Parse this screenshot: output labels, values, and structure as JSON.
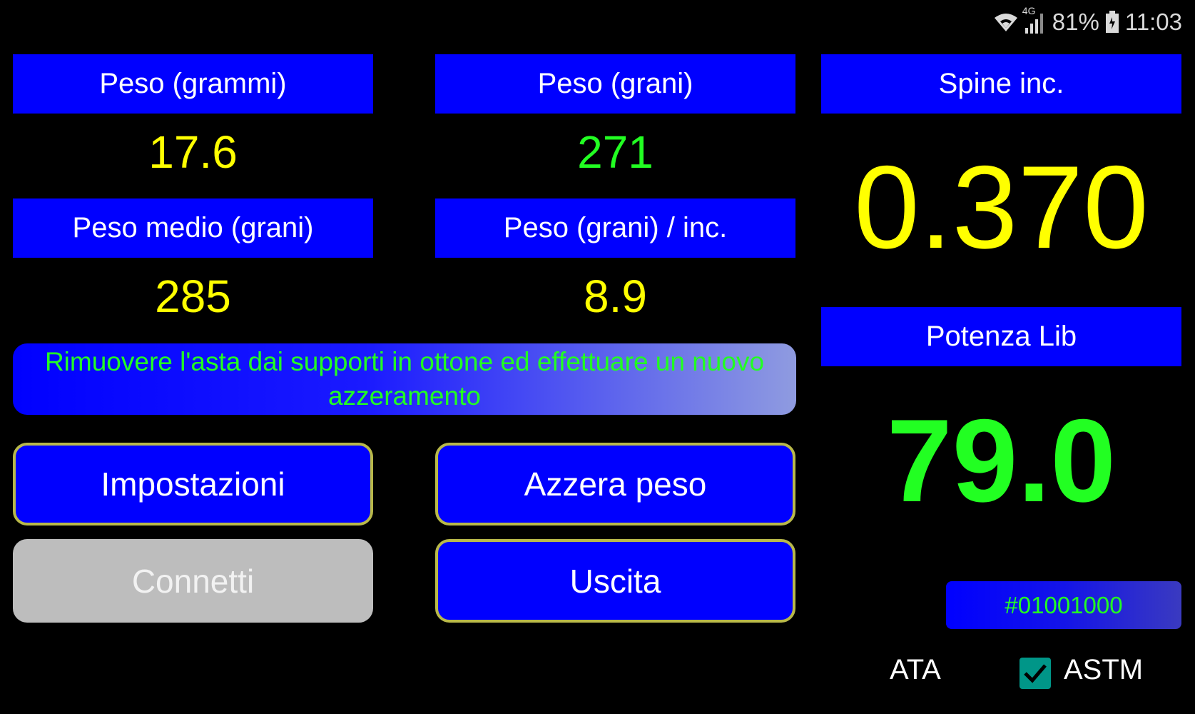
{
  "status_bar": {
    "network": "4G",
    "battery": "81%",
    "time": "11:03",
    "icons": [
      "wifi-icon",
      "signal-icon",
      "battery-icon"
    ]
  },
  "fields": {
    "weight_grams": {
      "label": "Peso (grammi)",
      "value": "17.6",
      "color": "#ffff00"
    },
    "weight_grains": {
      "label": "Peso (grani)",
      "value": "271",
      "color": "#22ff22"
    },
    "avg_weight_grains": {
      "label": "Peso medio (grani)",
      "value": "285",
      "color": "#ffff00"
    },
    "grains_per_inch": {
      "label": "Peso (grani) / inc.",
      "value": "8.9",
      "color": "#ffff00"
    },
    "spine": {
      "label": "Spine inc.",
      "value": "0.370",
      "color": "#ffff00"
    },
    "draw_weight": {
      "label": "Potenza Lib",
      "value": "79.0",
      "color": "#22ff22"
    }
  },
  "message": "Rimuovere l'asta dai supporti in ottone ed effettuare un nuovo azzeramento",
  "buttons": {
    "settings": "Impostazioni",
    "tare": "Azzera peso",
    "connect": "Connetti",
    "exit": "Uscita"
  },
  "device_id": "#01001000",
  "standards": {
    "ata_label": "ATA",
    "astm_label": "ASTM",
    "astm_checked": true
  },
  "colors": {
    "label_background": "#0000ff",
    "background": "#000000",
    "accent_yellow": "#ffff00",
    "accent_green": "#22ff22",
    "button_border": "#b8b84a",
    "disabled_button": "#bdbdbd",
    "checkbox": "#009688"
  }
}
